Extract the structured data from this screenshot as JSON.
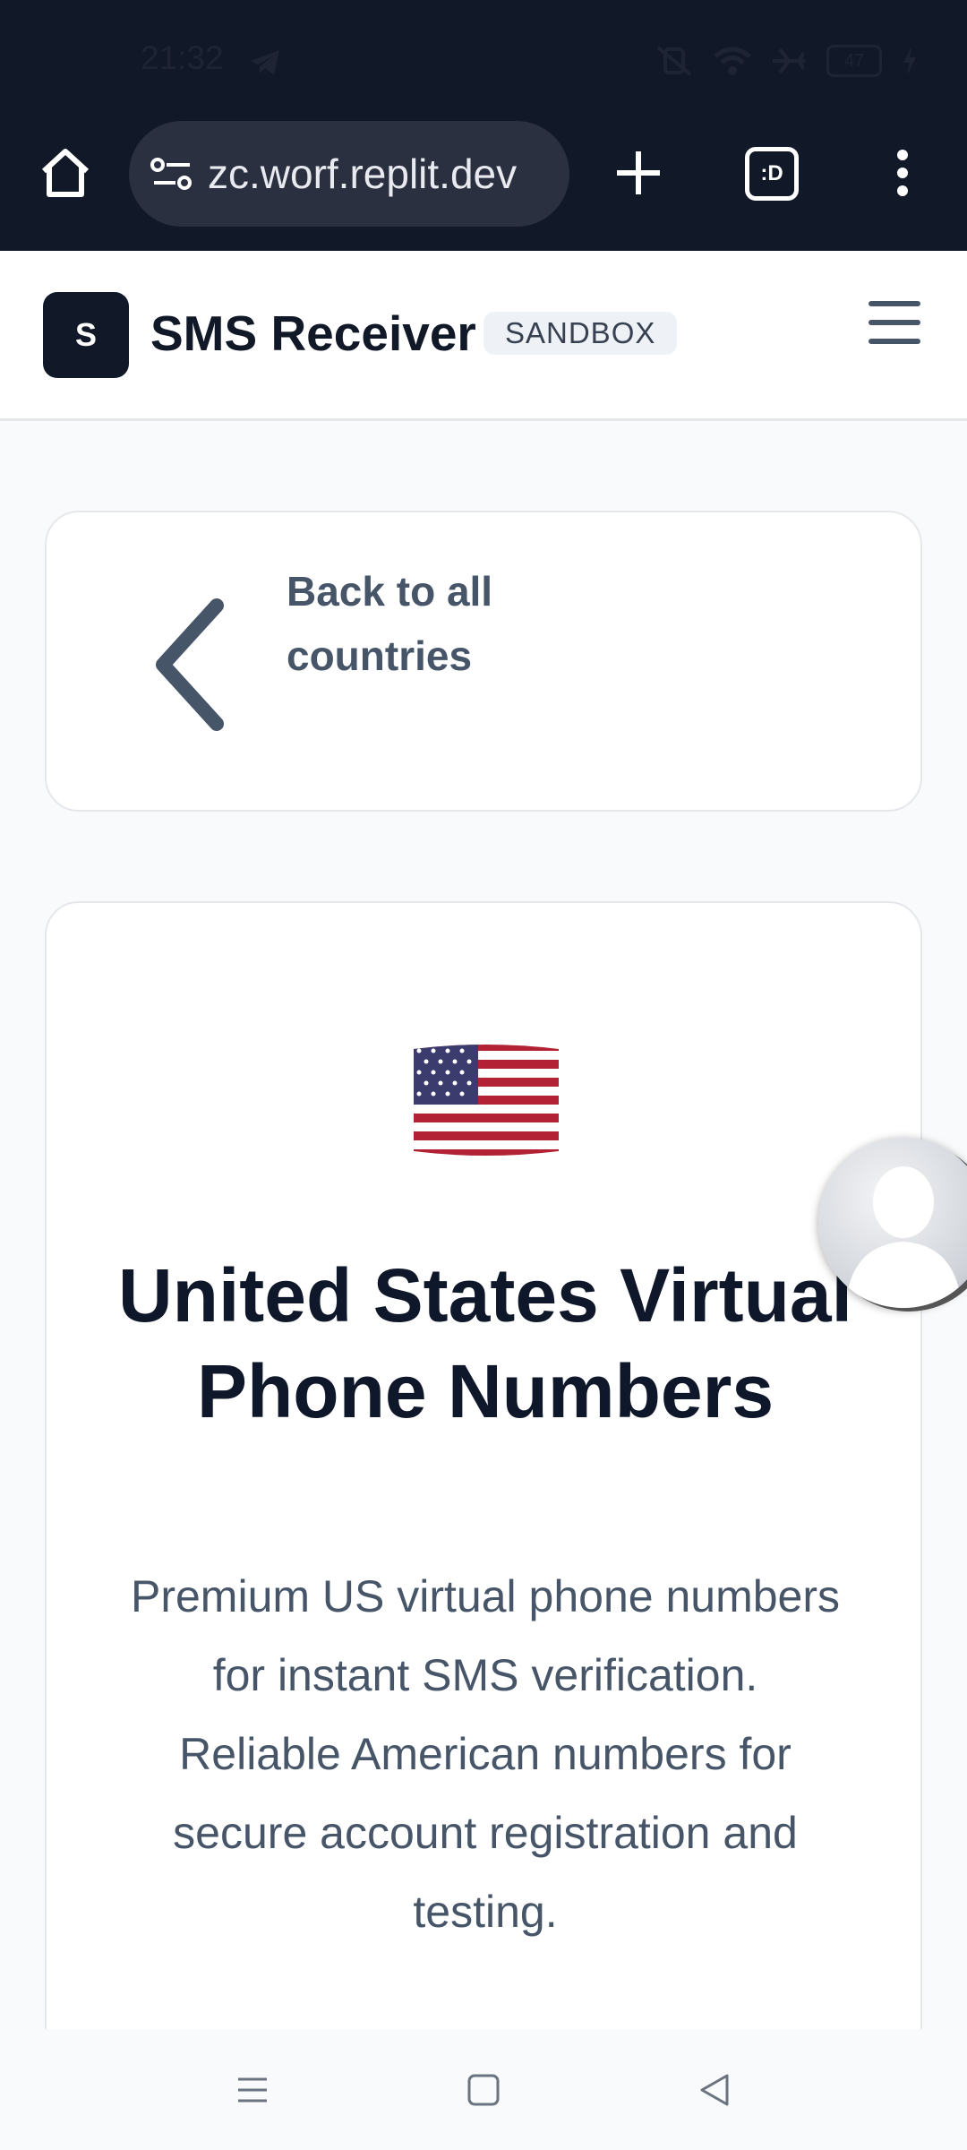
{
  "status_bar": {
    "time": "21:32",
    "battery": "47",
    "icons": [
      "telegram-icon",
      "vibrate-off-icon",
      "wifi-icon",
      "airplane-icon",
      "battery-icon",
      "charging-icon"
    ]
  },
  "browser": {
    "url": "zc.worf.replit.dev",
    "tab_count": ":D"
  },
  "header": {
    "logo_letter": "S",
    "brand": "SMS Receiver",
    "badge": "SANDBOX"
  },
  "back_link": {
    "label": "Back to all countries"
  },
  "country": {
    "flag": "🇺🇸",
    "title": "United States Virtual Phone Numbers",
    "description": "Premium US virtual phone numbers for instant SMS verification. Reliable American numbers for secure account registration and testing."
  },
  "colors": {
    "chrome_dark": "#111827",
    "page_bg": "#f8fafc",
    "title": "#0f172a",
    "muted": "#475569"
  }
}
